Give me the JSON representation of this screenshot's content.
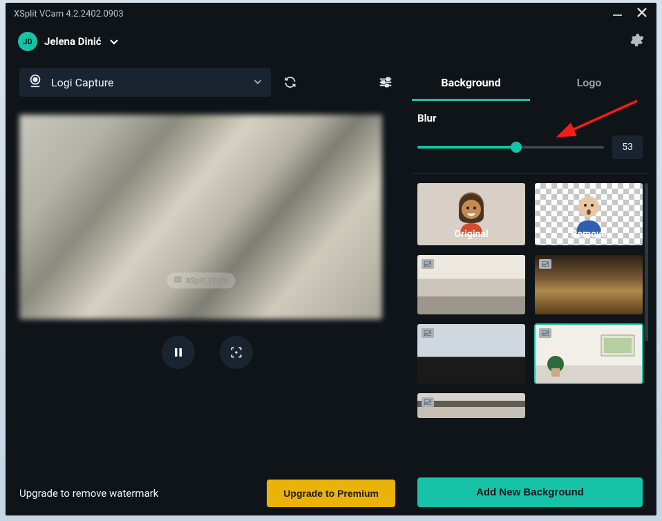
{
  "window": {
    "title": "XSplit VCam 4.2.2402.0903"
  },
  "user": {
    "initials": "JD",
    "name": "Jelena Dinić"
  },
  "camera": {
    "selected": "Logi Capture"
  },
  "watermark": {
    "text": "XSplit VCam"
  },
  "upgrade": {
    "hint": "Upgrade to remove watermark",
    "button": "Upgrade to Premium"
  },
  "tabs": {
    "background": "Background",
    "logo": "Logo",
    "active": "background"
  },
  "blur": {
    "label": "Blur",
    "value": 53,
    "min": 0,
    "max": 100
  },
  "backgrounds": {
    "original_label": "Original",
    "remove_label": "Remove",
    "selected_index": 5,
    "add_button": "Add New Background"
  },
  "colors": {
    "accent": "#17c3a6",
    "premium": "#eab308"
  }
}
